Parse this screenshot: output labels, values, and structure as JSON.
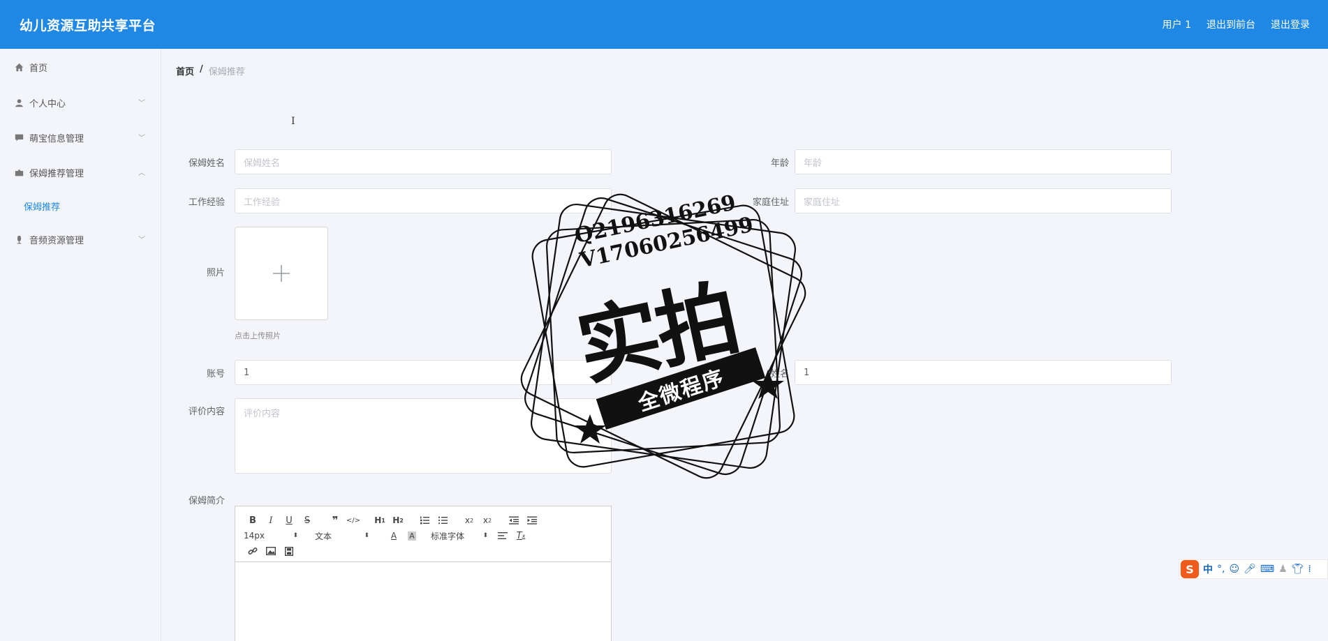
{
  "app": {
    "title": "幼儿资源互助共享平台"
  },
  "header": {
    "user": "用户 1",
    "to_front": "退出到前台",
    "logout": "退出登录"
  },
  "sidebar": {
    "items": [
      {
        "label": "首页",
        "icon": "home-icon"
      },
      {
        "label": "个人中心",
        "icon": "user-icon"
      },
      {
        "label": "萌宝信息管理",
        "icon": "chat-icon"
      },
      {
        "label": "保姆推荐管理",
        "icon": "folder-icon"
      },
      {
        "label": "音频资源管理",
        "icon": "microphone-icon"
      }
    ],
    "active_sub": "保姆推荐"
  },
  "breadcrumb": {
    "home": "首页",
    "sep": "/",
    "current": "保姆推荐"
  },
  "form": {
    "name_label": "保姆姓名",
    "name_placeholder": "保姆姓名",
    "age_label": "年龄",
    "age_placeholder": "年龄",
    "exp_label": "工作经验",
    "exp_placeholder": "工作经验",
    "addr_label": "家庭住址",
    "addr_placeholder": "家庭住址",
    "photo_label": "照片",
    "photo_hint": "点击上传照片",
    "account_label": "账号",
    "account_value": "1",
    "realname_label": "姓名",
    "realname_value": "1",
    "review_label": "评价内容",
    "review_placeholder": "评价内容",
    "intro_label": "保姆简介"
  },
  "editor": {
    "font_size": "14px",
    "block_type": "文本",
    "font_family": "标准字体"
  },
  "ime": {
    "mode": "中"
  },
  "watermark": {
    "line1": "Q2196316269",
    "line2": "V17060256499",
    "big": "实拍",
    "banner": "全微程序"
  }
}
